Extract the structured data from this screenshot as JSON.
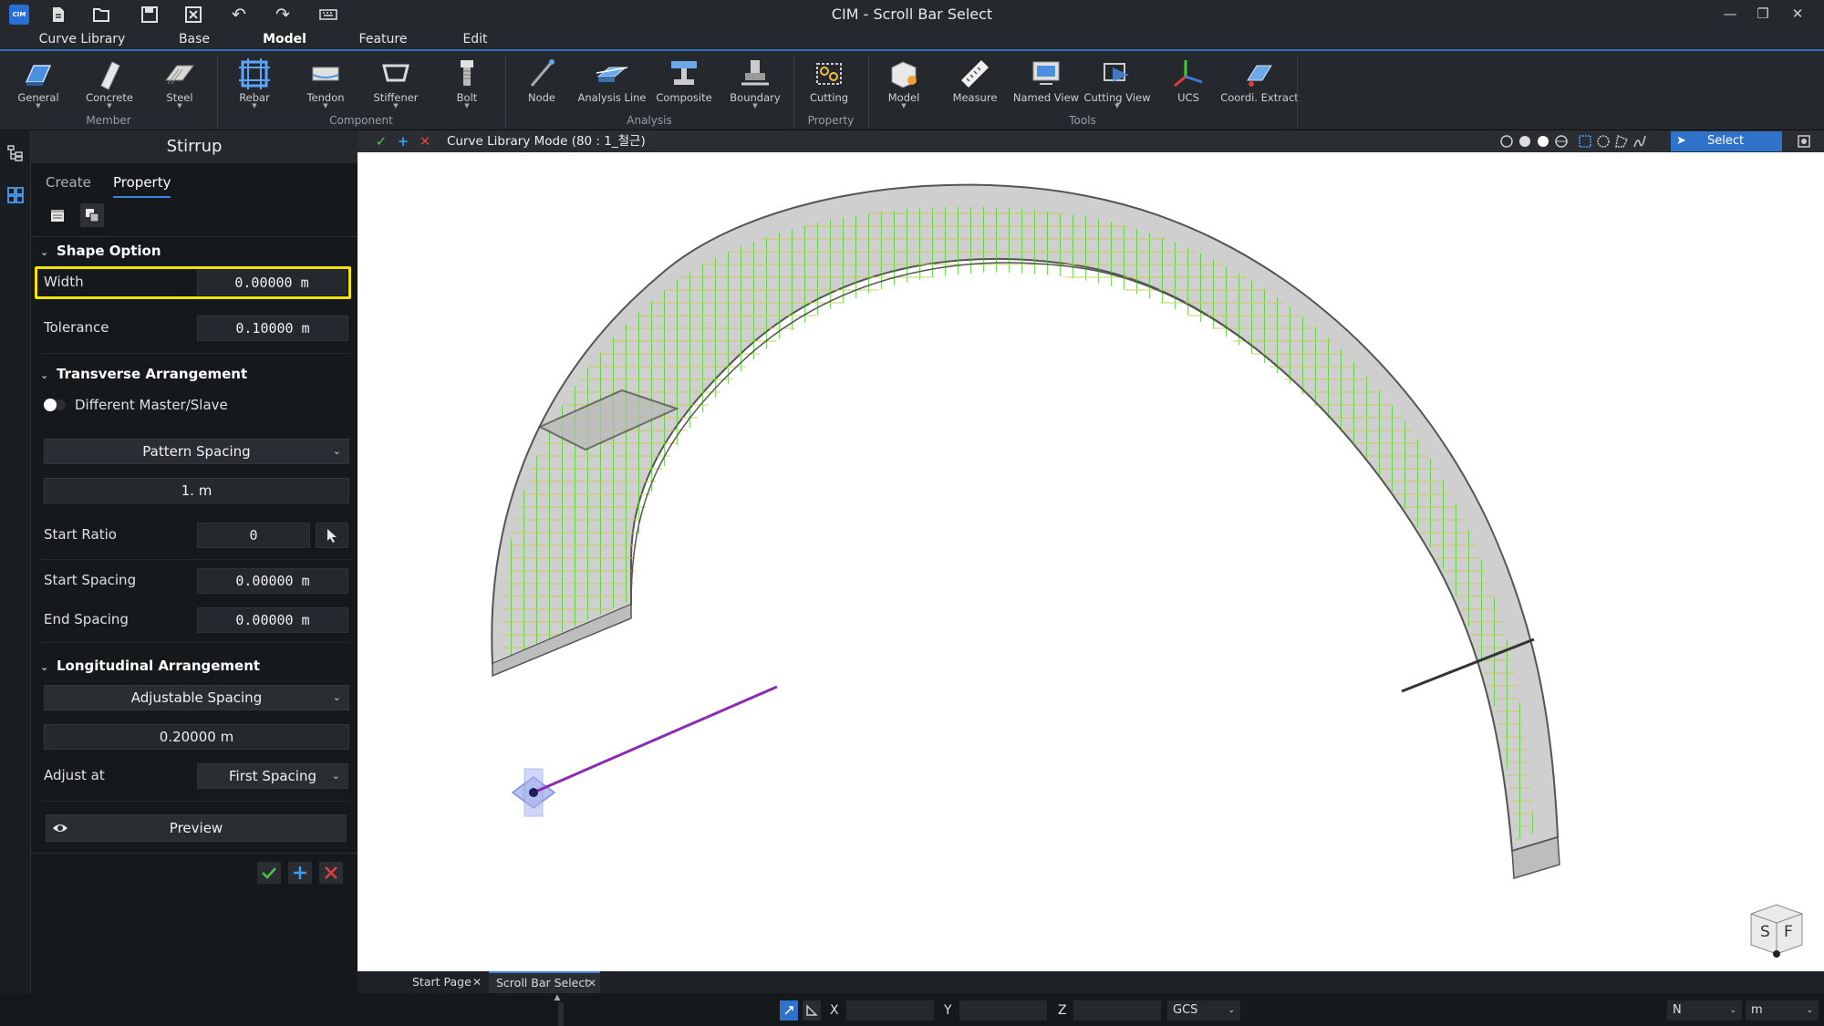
{
  "app": {
    "logo": "CIM",
    "title": "CIM - Scroll Bar Select"
  },
  "menu": {
    "tabs": [
      "Curve Library",
      "Base",
      "Model",
      "Feature",
      "Edit"
    ],
    "active": "Model"
  },
  "ribbon": {
    "buttons": [
      "General",
      "Concrete",
      "Steel",
      "Rebar",
      "Tendon",
      "Stiffener",
      "Bolt",
      "Node",
      "Analysis Line",
      "Composite",
      "Boundary",
      "Cutting",
      "Model",
      "Measure",
      "Named View",
      "Cutting View",
      "UCS",
      "Coordi. Extract"
    ],
    "groups": [
      "Member",
      "Component",
      "Analysis",
      "Property",
      "Tools"
    ]
  },
  "viewport_toolbar": {
    "mode": "Curve Library Mode (80 : 1_철근)",
    "select_label": "Select"
  },
  "panel": {
    "title": "Stirrup",
    "tabs": [
      "Create",
      "Property"
    ],
    "active_tab": "Property",
    "shape_option": {
      "header": "Shape Option",
      "width_label": "Width",
      "width_value": "0.00000 m",
      "tolerance_label": "Tolerance",
      "tolerance_value": "0.10000 m"
    },
    "transverse": {
      "header": "Transverse Arrangement",
      "toggle_label": "Different Master/Slave",
      "spacing_type": "Pattern Spacing",
      "pattern_value": "1. m",
      "start_ratio_label": "Start Ratio",
      "start_ratio_value": "0",
      "start_spacing_label": "Start Spacing",
      "start_spacing_value": "0.00000 m",
      "end_spacing_label": "End Spacing",
      "end_spacing_value": "0.00000 m"
    },
    "longitudinal": {
      "header": "Longitudinal Arrangement",
      "spacing_type": "Adjustable Spacing",
      "spacing_value": "0.20000 m",
      "adjust_label": "Adjust at",
      "adjust_value": "First Spacing"
    },
    "preview_label": "Preview"
  },
  "doc_tabs": [
    "Start Page",
    "Scroll Bar Select"
  ],
  "status": {
    "x_label": "X",
    "y_label": "Y",
    "z_label": "Z",
    "coord_system": "GCS",
    "force_unit": "N",
    "length_unit": "m"
  },
  "view_cube": {
    "left": "S",
    "right": "F"
  },
  "colors": {
    "accent": "#2e73c9",
    "highlight": "#f5e400",
    "rebar": "#39d11e",
    "confirm": "#4cc44c",
    "cancel": "#e04040"
  }
}
